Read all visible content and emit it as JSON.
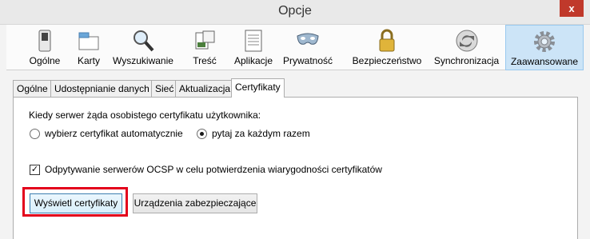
{
  "window": {
    "title": "Opcje",
    "close_glyph": "x"
  },
  "panes": [
    {
      "label": "Ogólne",
      "icon": "switch-icon"
    },
    {
      "label": "Karty",
      "icon": "tabs-icon"
    },
    {
      "label": "Wyszukiwanie",
      "icon": "magnifier-icon"
    },
    {
      "label": "Treść",
      "icon": "content-icon"
    },
    {
      "label": "Aplikacje",
      "icon": "applications-icon"
    },
    {
      "label": "Prywatność",
      "icon": "mask-icon"
    },
    {
      "label": "Bezpieczeństwo",
      "icon": "padlock-icon"
    },
    {
      "label": "Synchronizacja",
      "icon": "sync-icon"
    },
    {
      "label": "Zaawansowane",
      "icon": "gear-icon",
      "active": true
    }
  ],
  "subtabs": [
    {
      "label": "Ogólne"
    },
    {
      "label": "Udostępnianie danych"
    },
    {
      "label": "Sieć"
    },
    {
      "label": "Aktualizacja"
    },
    {
      "label": "Certyfikaty",
      "active": true
    }
  ],
  "certificates": {
    "question": "Kiedy serwer żąda osobistego certyfikatu użytkownika:",
    "radio_auto": {
      "label": "wybierz certyfikat automatycznie",
      "selected": false
    },
    "radio_ask": {
      "label": "pytaj za każdym razem",
      "selected": true
    },
    "ocsp": {
      "label": "Odpytywanie serwerów OCSP w celu potwierdzenia wiarygodności certyfikatów",
      "checked": true
    },
    "view_button": "Wyświetl certyfikaty",
    "devices_button": "Urządzenia zabezpieczające"
  },
  "colors": {
    "highlight_frame": "#e3001b",
    "active_pane": "#cce4f7"
  }
}
